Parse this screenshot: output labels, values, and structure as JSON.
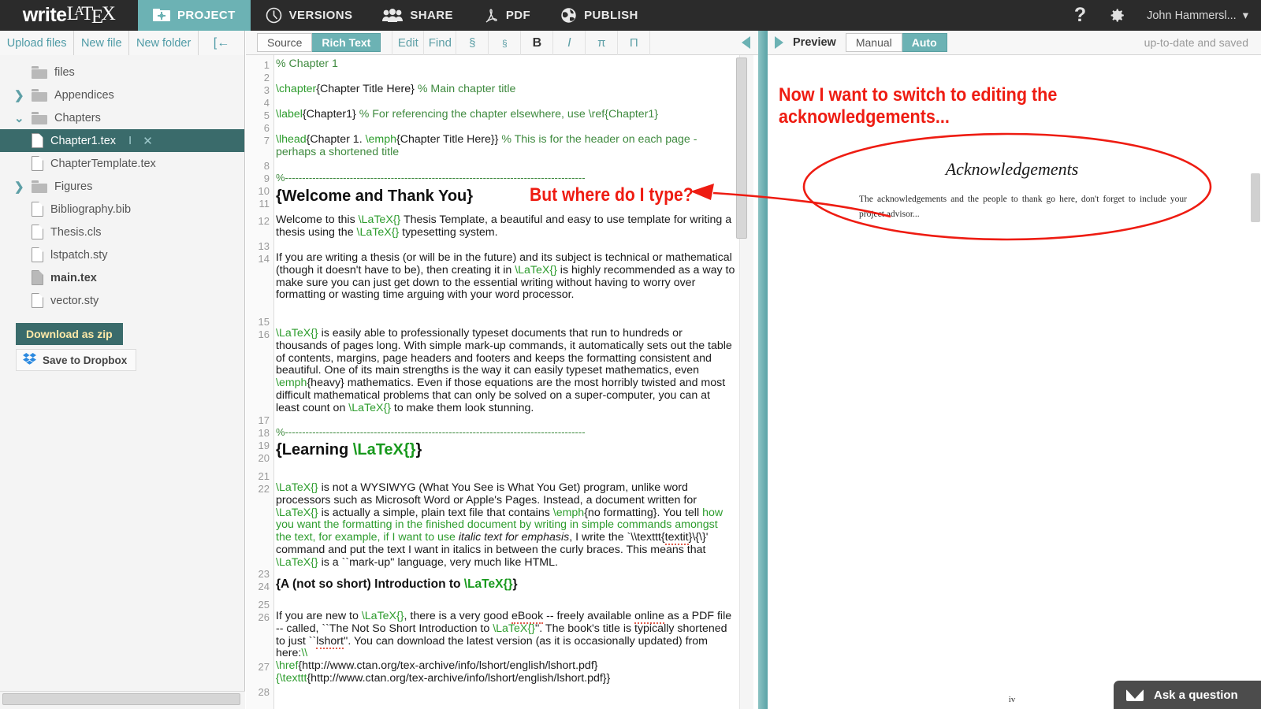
{
  "app": {
    "logo_write": "write",
    "logo_latex": "LATEX"
  },
  "topnav": {
    "items": [
      {
        "label": "PROJECT",
        "icon": "folder-icon",
        "active": true
      },
      {
        "label": "VERSIONS",
        "icon": "clock-icon",
        "active": false
      },
      {
        "label": "SHARE",
        "icon": "people-icon",
        "active": false
      },
      {
        "label": "PDF",
        "icon": "pdf-icon",
        "active": false
      },
      {
        "label": "PUBLISH",
        "icon": "globe-icon",
        "active": false
      }
    ],
    "help_icon": "question-mark-icon",
    "settings_icon": "gear-icon",
    "username": "John Hammersl...",
    "user_caret": "▾"
  },
  "sidebar": {
    "actions": [
      {
        "label": "Upload files"
      },
      {
        "label": "New file"
      },
      {
        "label": "New folder"
      },
      {
        "label": "[←"
      }
    ],
    "tree": [
      {
        "name": "files",
        "type": "folder",
        "chevron": "",
        "indent": 1,
        "selected": false,
        "bold": false
      },
      {
        "name": "Appendices",
        "type": "folder",
        "chevron": "❯",
        "indent": 1,
        "selected": false,
        "bold": false
      },
      {
        "name": "Chapters",
        "type": "folder",
        "chevron": "⌄",
        "indent": 1,
        "selected": false,
        "bold": false
      },
      {
        "name": "Chapter1.tex",
        "type": "file",
        "chevron": "",
        "indent": 2,
        "selected": true,
        "bold": false
      },
      {
        "name": "ChapterTemplate.tex",
        "type": "file",
        "chevron": "",
        "indent": 2,
        "selected": false,
        "bold": false
      },
      {
        "name": "Figures",
        "type": "folder",
        "chevron": "❯",
        "indent": 1,
        "selected": false,
        "bold": false
      },
      {
        "name": "Bibliography.bib",
        "type": "file",
        "chevron": "",
        "indent": 1,
        "selected": false,
        "bold": false
      },
      {
        "name": "Thesis.cls",
        "type": "file",
        "chevron": "",
        "indent": 1,
        "selected": false,
        "bold": false
      },
      {
        "name": "lstpatch.sty",
        "type": "file",
        "chevron": "",
        "indent": 1,
        "selected": false,
        "bold": false
      },
      {
        "name": "main.tex",
        "type": "file-filled",
        "chevron": "",
        "indent": 1,
        "selected": false,
        "bold": true
      },
      {
        "name": "vector.sty",
        "type": "file",
        "chevron": "",
        "indent": 1,
        "selected": false,
        "bold": false
      }
    ],
    "selected_row_icons": {
      "rename": "I",
      "delete": "✕"
    },
    "download_zip": "Download as zip",
    "dropbox": "Save to Dropbox",
    "dropbox_icon": "dropbox-icon"
  },
  "editor": {
    "toolbar": {
      "source": "Source",
      "rich_text": "Rich Text",
      "edit": "Edit",
      "find": "Find",
      "section": "§",
      "subsection": "§",
      "bold": "B",
      "italic": "I",
      "pi": "π",
      "pi_cap": "Π",
      "collapse_icon": "collapse-left-icon",
      "mode_active": "Rich Text"
    },
    "line_numbers": [
      1,
      2,
      3,
      5,
      6,
      7,
      8,
      9,
      10,
      11,
      12,
      13,
      14,
      15,
      16,
      17,
      18,
      19,
      20,
      21,
      22,
      23,
      24,
      25,
      26,
      27,
      28
    ],
    "lines": {
      "l1": "% Chapter 1",
      "l3_cmd": "\\chapter",
      "l3_arg": "{Chapter Title Here}",
      "l3_cmt": " % Main chapter title",
      "l5_cmd": "\\label",
      "l5_arg": "{Chapter1}",
      "l5_cmt": " % For referencing the chapter elsewhere, use \\ref{Chapter1}",
      "l7_cmd": "\\lhead",
      "l7_arg1": "{Chapter 1. ",
      "l7_cmd2": "\\emph",
      "l7_arg2": "{Chapter Title Here}}",
      "l7_cmt": " % This is for the header on each page - perhaps a shortened title",
      "l9_rule": "%----------------------------------------------------------------------------------------",
      "l11_head": "{Welcome and Thank You}",
      "l12_a": "Welcome to this ",
      "l12_tex": "\\LaTeX{}",
      "l12_b": " Thesis Template, a beautiful and easy to use template for writing a thesis using the ",
      "l12_c": " typesetting system.",
      "l14_a": "If you are writing a thesis (or will be in the future) and its subject is technical or mathematical (though it doesn't have to be), then creating it in ",
      "l14_b": " is highly recommended as a way to make sure you can just get down to the essential writing without having to worry over formatting or wasting time arguing with your word processor.",
      "l16_a": " is easily able to professionally typeset documents that run to hundreds or thousands of pages long. With simple mark-up commands, it automatically sets out the table of contents, margins, page headers and footers and keeps the formatting consistent and beautiful. One of its main strengths is the way it can easily typeset mathematics, even ",
      "l16_emph": "\\emph",
      "l16_emph_arg": "{heavy}",
      "l16_b": " mathematics. Even if those equations are the most horribly twisted and most difficult mathematical problems that can only be solved on a super-computer, you can at least count on ",
      "l16_c": " to make them look stunning.",
      "l18_rule": "%----------------------------------------------------------------------------------------",
      "l20_head_a": "{Learning ",
      "l20_head_b": "}",
      "l22_a": " is not a WYSIWYG (What You See is What You Get) program, unlike word processors such as Microsoft Word or Apple's Pages. Instead, a document written for ",
      "l22_b": " is actually a simple, plain text file that contains ",
      "l22_emph": "\\emph",
      "l22_emph_arg": "{no formatting}",
      "l22_c": ". You tell ",
      "l22_d": " how you want the formatting in the finished document by writing in simple commands amongst the text, for example, if I want to use ",
      "l22_ital": "italic text for emphasis",
      "l22_e": ", I write the `\\\\texttt{",
      "l22_spell": "textit",
      "l22_f": "}\\{\\}' command and put the text I want in italics in between the curly braces. This means that ",
      "l22_g": " is a ``mark-up'' language, very much like HTML.",
      "l24_head": "{A (not so short) Introduction to ",
      "l24_head_end": "}",
      "l26_a": "If you are new to ",
      "l26_b": ", there is a very good ",
      "l26_ebook": "eBook",
      "l26_c": " -- freely available ",
      "l26_online": "online",
      "l26_d": " as a PDF file -- called, ``The Not So Short Introduction to ",
      "l26_e": "''. The book's title is typically shortened to just ``",
      "l26_lshort": "lshort",
      "l26_f": "''. You can download the latest version (as it is occasionally updated) from here:",
      "l26_br": "\\\\",
      "l27_cmd": "\\href",
      "l27_url": "{http://www.ctan.org/tex-archive/info/lshort/english/lshort.pdf}",
      "l27_cmd2": "{\\texttt",
      "l27_url2": "{http://www.ctan.org/tex-archive/info/lshort/english/lshort.pdf}}"
    }
  },
  "preview": {
    "expand_icon": "expand-right-icon",
    "label": "Preview",
    "manual": "Manual",
    "auto": "Auto",
    "mode_active": "Auto",
    "status": "up-to-date and saved",
    "document": {
      "title": "Acknowledgements",
      "body": "The acknowledgements and the people to thank go here, don't forget to include your project advisor...",
      "page_number": "iv"
    }
  },
  "annotations": {
    "where_do_i_type": "But where do I type?",
    "switch_to_ack": "Now I want to switch to editing the acknowledgements...",
    "color": "#ee1c12"
  },
  "support": {
    "ask_label": "Ask a question",
    "ask_icon": "envelope-icon"
  },
  "colors": {
    "accent_teal": "#6cb2b4",
    "dark_bar": "#2b2b2b",
    "selected_row": "#3a6b6b",
    "annotation_red": "#ee1c12",
    "latex_green": "#2d9c2d",
    "comment_green": "#3f8a3f",
    "brace_purple": "#4b2fb5"
  }
}
